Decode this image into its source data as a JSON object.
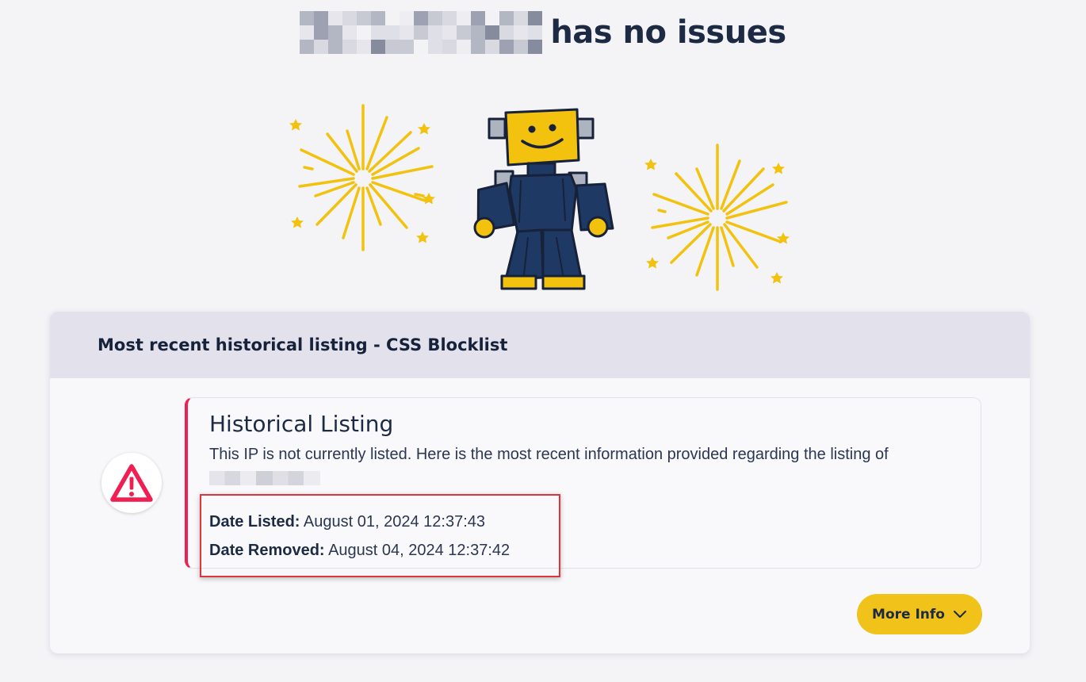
{
  "headline": {
    "status_text": "has no issues"
  },
  "card": {
    "header_title": "Most recent historical listing - CSS Blocklist",
    "listing": {
      "title": "Historical Listing",
      "description": "This IP is not currently listed. Here is the most recent information provided regarding the listing of",
      "date_listed_label": "Date Listed:",
      "date_listed_value": "August 01, 2024 12:37:43",
      "date_removed_label": "Date Removed:",
      "date_removed_value": "August 04, 2024 12:37:42"
    },
    "more_info_label": "More Info"
  },
  "colors": {
    "page_bg": "#f4f4f7",
    "header_bg": "#e2e1ec",
    "accent_red": "#ee1f52",
    "button_yellow": "#f0c21a",
    "navy": "#1c2a44",
    "highlight_outline": "#e0343c"
  },
  "icons": [
    "warning-triangle-icon",
    "chevron-down-icon",
    "robot-illustration",
    "firework-icon"
  ]
}
